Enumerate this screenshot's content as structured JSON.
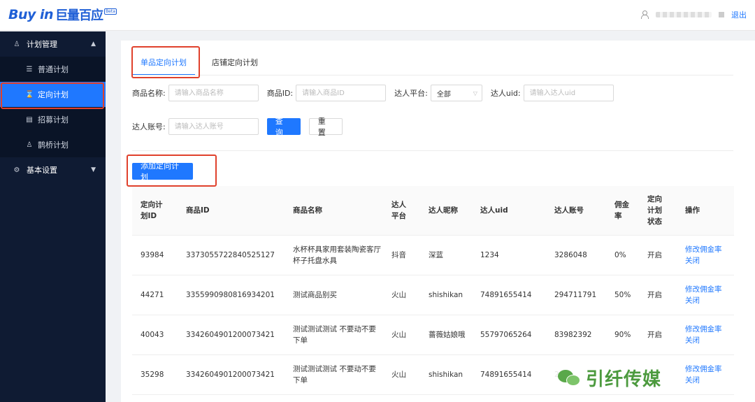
{
  "header": {
    "logo_text": "Buy in",
    "logo_cn": "巨量百应",
    "logo_badge": "Beta",
    "logout_label": "退出"
  },
  "sidebar": {
    "groups": [
      {
        "label": "计划管理",
        "icon": "people-icon",
        "expanded": true,
        "items": [
          {
            "label": "普通计划",
            "icon": "list-icon",
            "active": false
          },
          {
            "label": "定向计划",
            "icon": "hourglass-icon",
            "active": true
          },
          {
            "label": "招募计划",
            "icon": "recruit-icon",
            "active": false
          },
          {
            "label": "鹊桥计划",
            "icon": "people-icon",
            "active": false
          }
        ]
      },
      {
        "label": "基本设置",
        "icon": "gear-icon",
        "expanded": false
      }
    ]
  },
  "tabs": [
    {
      "label": "单品定向计划",
      "active": true
    },
    {
      "label": "店铺定向计划",
      "active": false
    }
  ],
  "filters": {
    "product_name_label": "商品名称:",
    "product_name_placeholder": "请输入商品名称",
    "product_id_label": "商品ID:",
    "product_id_placeholder": "请输入商品ID",
    "platform_label": "达人平台:",
    "platform_value": "全部",
    "uid_label": "达人uid:",
    "uid_placeholder": "请输入达人uid",
    "account_label": "达人账号:",
    "account_placeholder": "请输入达人账号",
    "search_label": "查 询",
    "reset_label": "重 置"
  },
  "add_button_label": "添加定向计划",
  "table": {
    "headers": [
      "定向计划ID",
      "商品ID",
      "商品名称",
      "达人平台",
      "达人昵称",
      "达人uid",
      "达人账号",
      "佣金率",
      "定向计划状态",
      "操作"
    ],
    "rows": [
      {
        "id": "93984",
        "product_id": "3373055722840525127",
        "product_name": "水杯杯具家用套装陶瓷客厅杯子托盘水具",
        "platform": "抖音",
        "nickname": "深蓝",
        "uid": "1234",
        "account": "3286048",
        "rate": "0%",
        "status": "开启",
        "action1": "修改佣金率",
        "action2": "关闭"
      },
      {
        "id": "44271",
        "product_id": "3355990980816934201",
        "product_name": "测试商品别买",
        "platform": "火山",
        "nickname": "shishikan",
        "uid": "74891655414",
        "account": "294711791",
        "rate": "50%",
        "status": "开启",
        "action1": "修改佣金率",
        "action2": "关闭"
      },
      {
        "id": "40043",
        "product_id": "3342604901200073421",
        "product_name": "测试测试测试 不要动不要下单",
        "platform": "火山",
        "nickname": "蔷薇姑娘哦",
        "uid": "55797065264",
        "account": "83982392",
        "rate": "90%",
        "status": "开启",
        "action1": "修改佣金率",
        "action2": "关闭"
      },
      {
        "id": "35298",
        "product_id": "3342604901200073421",
        "product_name": "测试测试测试 不要动不要下单",
        "platform": "火山",
        "nickname": "shishikan",
        "uid": "74891655414",
        "account": "2",
        "rate": "",
        "status": "",
        "action1": "修改佣金率",
        "action2": "关闭"
      }
    ]
  },
  "watermark": {
    "text": "引纤传媒"
  },
  "colors": {
    "accent": "#1f78ff",
    "sidebar_bg": "#0f1b33",
    "highlight_box": "#e0412c"
  }
}
